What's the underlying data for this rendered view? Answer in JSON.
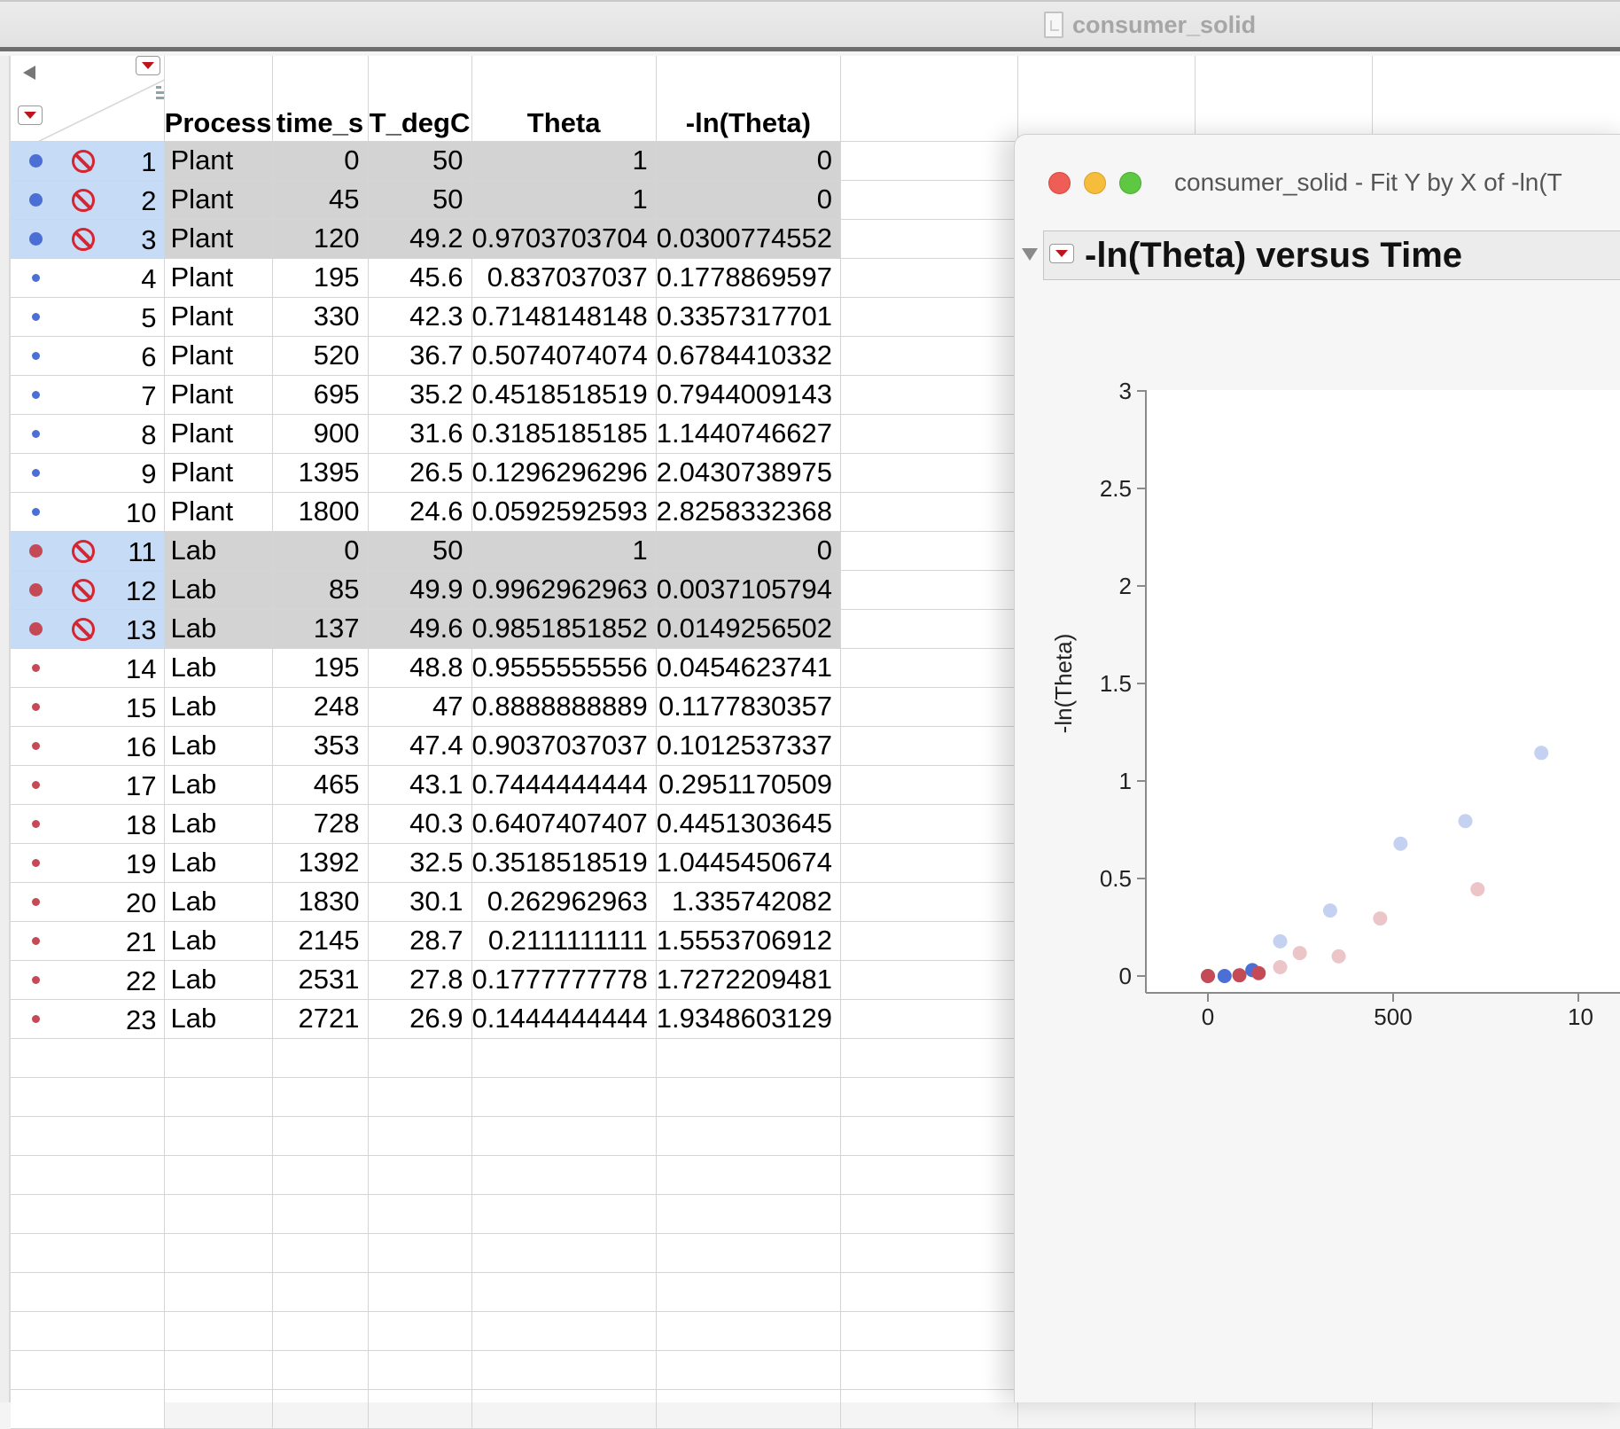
{
  "window": {
    "title": "consumer_solid"
  },
  "table": {
    "columns": [
      "Process",
      "time_s",
      "T_degC",
      "Theta",
      "-ln(Theta)"
    ],
    "rows": [
      {
        "n": "1",
        "process": "Plant",
        "time": "0",
        "temp": "50",
        "theta": "1",
        "lntheta": "0",
        "group": "blue",
        "selected": true,
        "excluded": true
      },
      {
        "n": "2",
        "process": "Plant",
        "time": "45",
        "temp": "50",
        "theta": "1",
        "lntheta": "0",
        "group": "blue",
        "selected": true,
        "excluded": true
      },
      {
        "n": "3",
        "process": "Plant",
        "time": "120",
        "temp": "49.2",
        "theta": "0.9703703704",
        "lntheta": "0.0300774552",
        "group": "blue",
        "selected": true,
        "excluded": true
      },
      {
        "n": "4",
        "process": "Plant",
        "time": "195",
        "temp": "45.6",
        "theta": "0.837037037",
        "lntheta": "0.1778869597",
        "group": "blue",
        "selected": false,
        "excluded": false
      },
      {
        "n": "5",
        "process": "Plant",
        "time": "330",
        "temp": "42.3",
        "theta": "0.7148148148",
        "lntheta": "0.3357317701",
        "group": "blue",
        "selected": false,
        "excluded": false
      },
      {
        "n": "6",
        "process": "Plant",
        "time": "520",
        "temp": "36.7",
        "theta": "0.5074074074",
        "lntheta": "0.6784410332",
        "group": "blue",
        "selected": false,
        "excluded": false
      },
      {
        "n": "7",
        "process": "Plant",
        "time": "695",
        "temp": "35.2",
        "theta": "0.4518518519",
        "lntheta": "0.7944009143",
        "group": "blue",
        "selected": false,
        "excluded": false
      },
      {
        "n": "8",
        "process": "Plant",
        "time": "900",
        "temp": "31.6",
        "theta": "0.3185185185",
        "lntheta": "1.1440746627",
        "group": "blue",
        "selected": false,
        "excluded": false
      },
      {
        "n": "9",
        "process": "Plant",
        "time": "1395",
        "temp": "26.5",
        "theta": "0.1296296296",
        "lntheta": "2.0430738975",
        "group": "blue",
        "selected": false,
        "excluded": false
      },
      {
        "n": "10",
        "process": "Plant",
        "time": "1800",
        "temp": "24.6",
        "theta": "0.0592592593",
        "lntheta": "2.8258332368",
        "group": "blue",
        "selected": false,
        "excluded": false
      },
      {
        "n": "11",
        "process": "Lab",
        "time": "0",
        "temp": "50",
        "theta": "1",
        "lntheta": "0",
        "group": "red",
        "selected": true,
        "excluded": true
      },
      {
        "n": "12",
        "process": "Lab",
        "time": "85",
        "temp": "49.9",
        "theta": "0.9962962963",
        "lntheta": "0.0037105794",
        "group": "red",
        "selected": true,
        "excluded": true
      },
      {
        "n": "13",
        "process": "Lab",
        "time": "137",
        "temp": "49.6",
        "theta": "0.9851851852",
        "lntheta": "0.0149256502",
        "group": "red",
        "selected": true,
        "excluded": true
      },
      {
        "n": "14",
        "process": "Lab",
        "time": "195",
        "temp": "48.8",
        "theta": "0.9555555556",
        "lntheta": "0.0454623741",
        "group": "red",
        "selected": false,
        "excluded": false
      },
      {
        "n": "15",
        "process": "Lab",
        "time": "248",
        "temp": "47",
        "theta": "0.8888888889",
        "lntheta": "0.1177830357",
        "group": "red",
        "selected": false,
        "excluded": false
      },
      {
        "n": "16",
        "process": "Lab",
        "time": "353",
        "temp": "47.4",
        "theta": "0.9037037037",
        "lntheta": "0.1012537337",
        "group": "red",
        "selected": false,
        "excluded": false
      },
      {
        "n": "17",
        "process": "Lab",
        "time": "465",
        "temp": "43.1",
        "theta": "0.7444444444",
        "lntheta": "0.2951170509",
        "group": "red",
        "selected": false,
        "excluded": false
      },
      {
        "n": "18",
        "process": "Lab",
        "time": "728",
        "temp": "40.3",
        "theta": "0.6407407407",
        "lntheta": "0.4451303645",
        "group": "red",
        "selected": false,
        "excluded": false
      },
      {
        "n": "19",
        "process": "Lab",
        "time": "1392",
        "temp": "32.5",
        "theta": "0.3518518519",
        "lntheta": "1.0445450674",
        "group": "red",
        "selected": false,
        "excluded": false
      },
      {
        "n": "20",
        "process": "Lab",
        "time": "1830",
        "temp": "30.1",
        "theta": "0.262962963",
        "lntheta": "1.335742082",
        "group": "red",
        "selected": false,
        "excluded": false
      },
      {
        "n": "21",
        "process": "Lab",
        "time": "2145",
        "temp": "28.7",
        "theta": "0.2111111111",
        "lntheta": "1.5553706912",
        "group": "red",
        "selected": false,
        "excluded": false
      },
      {
        "n": "22",
        "process": "Lab",
        "time": "2531",
        "temp": "27.8",
        "theta": "0.1777777778",
        "lntheta": "1.7272209481",
        "group": "red",
        "selected": false,
        "excluded": false
      },
      {
        "n": "23",
        "process": "Lab",
        "time": "2721",
        "temp": "26.9",
        "theta": "0.1444444444",
        "lntheta": "1.9348603129",
        "group": "red",
        "selected": false,
        "excluded": false
      }
    ],
    "empty_rows": 10
  },
  "report": {
    "window_title": "consumer_solid - Fit Y by X of -ln(T",
    "outline_title": "-ln(Theta) versus Time"
  },
  "colors": {
    "plant": "#4b6fd4",
    "lab": "#c44b56",
    "selected_row": "#c6dbf6",
    "selected_cell": "#d3d3d3"
  },
  "chart_data": {
    "type": "scatter",
    "ylabel": "-ln(Theta)",
    "xlabel": "",
    "ylim": [
      -0.05,
      3
    ],
    "yticks": [
      "0",
      "0.5",
      "1",
      "1.5",
      "2",
      "2.5",
      "3"
    ],
    "xticks": [
      "0",
      "500",
      "10"
    ],
    "series": [
      {
        "color": "#4b6fd4",
        "points": [
          [
            0,
            0
          ],
          [
            45,
            0
          ],
          [
            120,
            0.0300774552
          ],
          [
            195,
            0.1778869597
          ],
          [
            330,
            0.3357317701
          ],
          [
            520,
            0.6784410332
          ],
          [
            695,
            0.7944009143
          ],
          [
            900,
            1.1440746627
          ]
        ]
      },
      {
        "color": "#c44b56",
        "points": [
          [
            0,
            0
          ],
          [
            85,
            0.0037105794
          ],
          [
            137,
            0.0149256502
          ],
          [
            195,
            0.0454623741
          ],
          [
            248,
            0.1177830357
          ],
          [
            353,
            0.1012537337
          ],
          [
            465,
            0.2951170509
          ],
          [
            728,
            0.4451303645
          ]
        ]
      }
    ],
    "excluded_points_solid": [
      0,
      1,
      2
    ]
  }
}
